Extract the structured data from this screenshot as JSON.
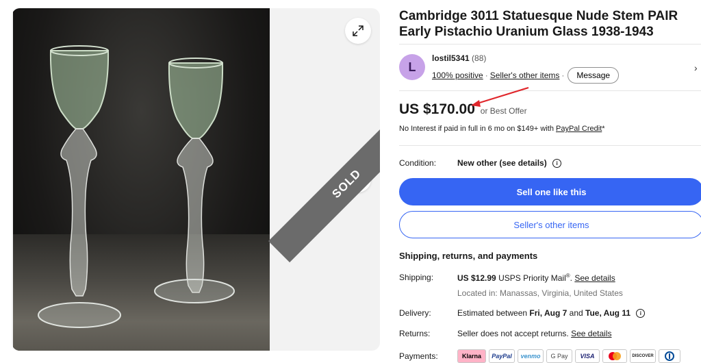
{
  "listing": {
    "title": "Cambridge 3011 Statuesque Nude Stem PAIR Early Pistachio Uranium Glass 1938-1943",
    "sold_ribbon": "SOLD"
  },
  "seller": {
    "avatar_letter": "L",
    "name": "lostil5341",
    "feedback_count": "(88)",
    "positive": "100% positive",
    "other_items_link": "Seller's other items",
    "message_button": "Message"
  },
  "price": {
    "amount": "US $170.00",
    "offer": "or Best Offer"
  },
  "financing": {
    "text": "No Interest if paid in full in 6 mo on $149+ with",
    "link": "PayPal Credit",
    "suffix": "*"
  },
  "condition": {
    "label": "Condition:",
    "value": "New other (see details)"
  },
  "buttons": {
    "sell_one": "Sell one like this",
    "sellers_other": "Seller's other items"
  },
  "shipping_section": {
    "heading": "Shipping, returns, and payments",
    "shipping_label": "Shipping:",
    "shipping_value": "US $12.99",
    "shipping_service": "USPS Priority Mail",
    "shipping_reg": "®",
    "shipping_link": "See details",
    "location": "Located in: Manassas, Virginia, United States",
    "delivery_label": "Delivery:",
    "delivery_prefix": "Estimated between",
    "delivery_start": "Fri, Aug 7",
    "delivery_and": "and",
    "delivery_end": "Tue, Aug 11",
    "returns_label": "Returns:",
    "returns_value": "Seller does not accept returns.",
    "returns_link": "See details",
    "payments_label": "Payments:",
    "payment_methods": [
      "Klarna",
      "PayPal",
      "venmo",
      "G Pay",
      "VISA",
      "",
      "DISCOVER",
      ""
    ]
  },
  "colors": {
    "accent": "#3665f3",
    "avatar_bg": "#c7a2e8",
    "arrow": "#e0262b",
    "sold_ribbon": "#6b6b6b"
  },
  "icons": {
    "expand": "expand-icon",
    "next": "chevron-right-icon",
    "info": "info-icon"
  }
}
